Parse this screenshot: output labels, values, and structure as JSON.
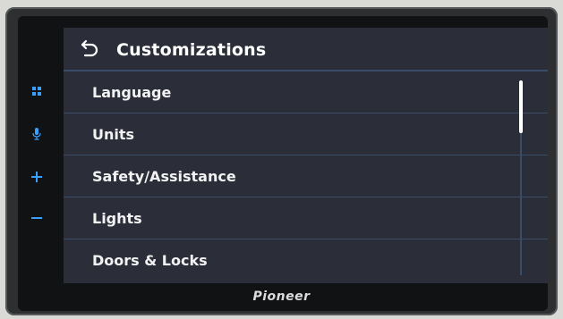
{
  "header": {
    "title": "Customizations"
  },
  "menu": {
    "items": [
      {
        "label": "Language"
      },
      {
        "label": "Units"
      },
      {
        "label": "Safety/Assistance"
      },
      {
        "label": "Lights"
      },
      {
        "label": "Doors & Locks"
      }
    ]
  },
  "side_buttons": [
    {
      "icon": "grid-icon",
      "glyph": "▪▪"
    },
    {
      "icon": "microphone-icon",
      "glyph": "🎙"
    },
    {
      "icon": "plus-icon",
      "glyph": "+"
    },
    {
      "icon": "minus-icon",
      "glyph": "−"
    }
  ],
  "brand": {
    "name": "Pioneer"
  },
  "colors": {
    "screen_bg": "#2b2e39",
    "divider": "#3a4d68",
    "side_button_accent": "#3aa0ff",
    "text": "#ffffff"
  }
}
